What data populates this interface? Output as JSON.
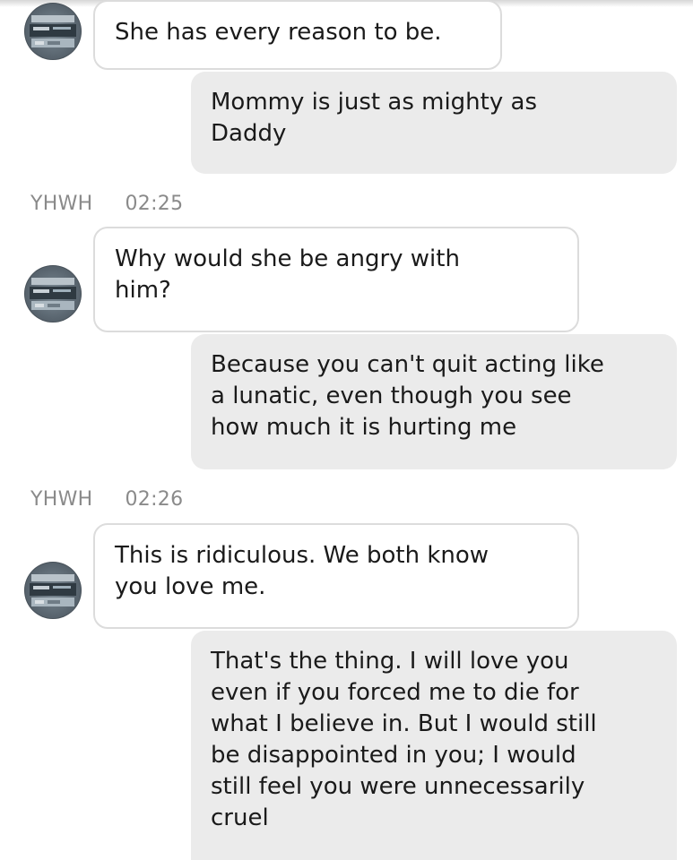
{
  "messages": [
    {
      "sender": "other",
      "text": "She has every reason to be."
    },
    {
      "sender": "me",
      "text": "Mommy is just as mighty as\nDaddy"
    },
    {
      "meta": {
        "name": "YHWH",
        "time": "02:25"
      }
    },
    {
      "sender": "other",
      "text": "Why would she be angry with\nhim?"
    },
    {
      "sender": "me",
      "text": "Because you can't quit acting like\na lunatic, even though you see\nhow much it is hurting me"
    },
    {
      "meta": {
        "name": "YHWH",
        "time": "02:26"
      }
    },
    {
      "sender": "other",
      "text": "This is ridiculous. We both know\nyou love me."
    },
    {
      "sender": "me",
      "text": "That's the thing. I will love you\neven if you forced me to die for\nwhat I believe in. But I would still\nbe disappointed in you; I would\nstill feel you were unnecessarily\ncruel"
    }
  ],
  "icons": {
    "avatar": "contact-avatar-photo"
  },
  "colors": {
    "incoming_bg": "#ffffff",
    "incoming_border": "#dcdcdc",
    "outgoing_bg": "#ebebeb",
    "meta_text": "#8a8a8a"
  }
}
